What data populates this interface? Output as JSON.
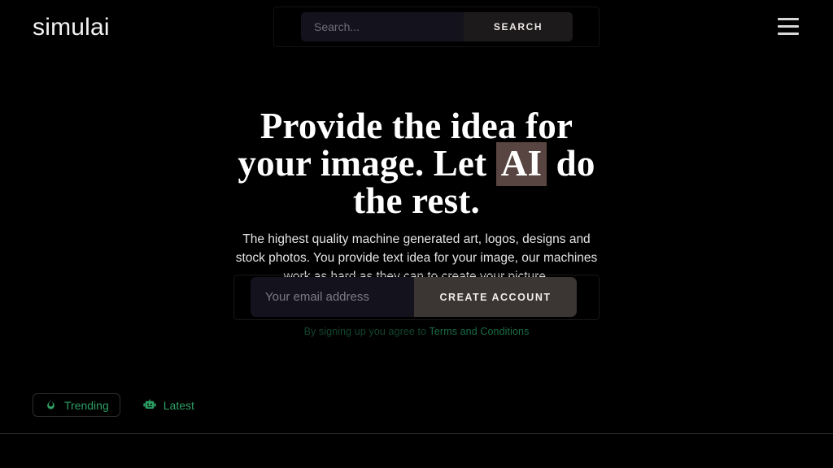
{
  "header": {
    "logo": "simulai",
    "search": {
      "placeholder": "Search...",
      "value": "",
      "button_label": "SEARCH"
    },
    "menu_label": "Menu"
  },
  "hero": {
    "headline_part1": "Provide the idea for your image. Let ",
    "headline_highlight": "AI",
    "headline_part2": " do the rest.",
    "highlight_color": "#584440",
    "subtitle": "The highest quality machine generated art, logos, designs and stock photos. You provide text idea for your image, our machines work as hard as they can to create your picture."
  },
  "signup": {
    "email_placeholder": "Your email address",
    "email_value": "",
    "submit_label": "CREATE ACCOUNT",
    "terms_prefix": "By signing up you agree to ",
    "terms_link": "Terms and Conditions",
    "terms_color": "#13452f",
    "link_color": "#1a6b46"
  },
  "tabs": {
    "accent_color": "#2e9e63",
    "items": [
      {
        "label": "Trending",
        "icon": "flame-icon",
        "active": true
      },
      {
        "label": "Latest",
        "icon": "robot-icon",
        "active": false
      }
    ]
  }
}
